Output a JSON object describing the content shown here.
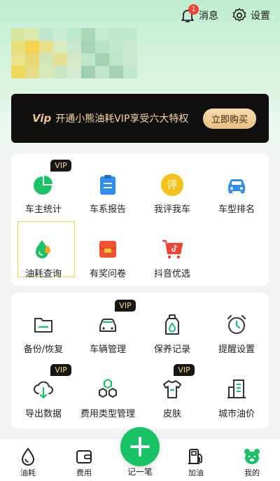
{
  "header": {
    "messages_label": "消息",
    "messages_badge": "1",
    "settings_label": "设置"
  },
  "vip_banner": {
    "logo": "Vip",
    "text": "开通小熊油耗VIP享受六大特权",
    "button": "立即购买"
  },
  "section1": {
    "items": [
      {
        "label": "车主统计",
        "icon": "pie-chart-icon",
        "vip": "VIP"
      },
      {
        "label": "车系报告",
        "icon": "clipboard-icon"
      },
      {
        "label": "我评我车",
        "icon": "review-icon",
        "icon_text": "评"
      },
      {
        "label": "车型排名",
        "icon": "car-icon"
      },
      {
        "label": "油耗查询",
        "icon": "fuel-drop-icon"
      },
      {
        "label": "有奖问卷",
        "icon": "red-envelope-icon"
      },
      {
        "label": "抖音优选",
        "icon": "tiktok-cart-icon"
      }
    ]
  },
  "section2": {
    "items": [
      {
        "label": "备份/恢复",
        "icon": "folder-icon"
      },
      {
        "label": "车辆管理",
        "icon": "car-outline-icon",
        "vip": "VIP"
      },
      {
        "label": "保养记录",
        "icon": "oil-bottle-icon"
      },
      {
        "label": "提醒设置",
        "icon": "alarm-clock-icon"
      },
      {
        "label": "导出数据",
        "icon": "cloud-download-icon",
        "vip": "VIP"
      },
      {
        "label": "费用类型管理",
        "icon": "hexagons-icon"
      },
      {
        "label": "皮肤",
        "icon": "tshirt-icon",
        "vip": "VIP"
      },
      {
        "label": "城市油价",
        "icon": "buildings-icon"
      }
    ]
  },
  "nav": {
    "items": [
      {
        "label": "油耗",
        "icon": "drop-icon"
      },
      {
        "label": "费用",
        "icon": "wallet-icon"
      },
      {
        "label": "记一笔",
        "icon": "plus-icon"
      },
      {
        "label": "加油",
        "icon": "gas-pump-icon"
      },
      {
        "label": "我的",
        "icon": "bear-icon"
      }
    ]
  },
  "colors": {
    "accent": "#19c265",
    "vip_gold": "#f1d7a9",
    "badge": "#f0443a"
  }
}
